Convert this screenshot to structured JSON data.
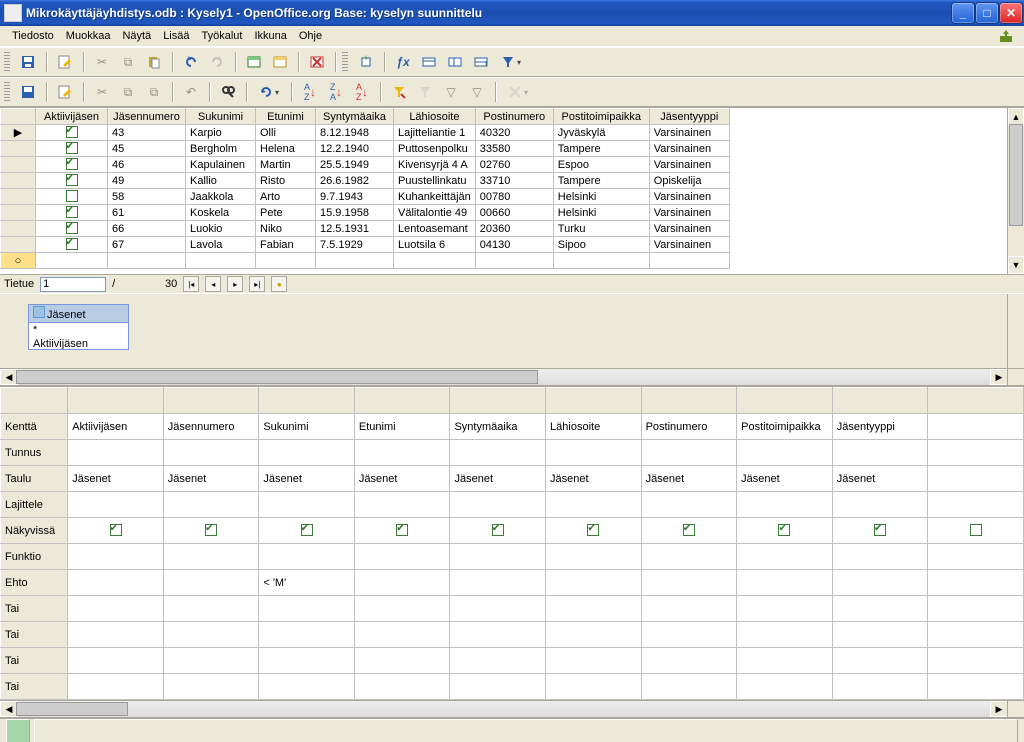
{
  "title": "Mikrokäyttäjäyhdistys.odb : Kysely1 - OpenOffice.org Base: kyselyn suunnittelu",
  "menus": [
    "Tiedosto",
    "Muokkaa",
    "Näytä",
    "Lisää",
    "Työkalut",
    "Ikkuna",
    "Ohje"
  ],
  "preview": {
    "columns": [
      "Aktiivijäsen",
      "Jäsennumero",
      "Sukunimi",
      "Etunimi",
      "Syntymäaika",
      "Lähiosoite",
      "Postinumero",
      "Postitoimipaikka",
      "Jäsentyyppi"
    ],
    "rows": [
      {
        "active": true,
        "jno": "43",
        "suk": "Karpio",
        "etu": "Olli",
        "synt": "8.12.1948",
        "lah": "Lajitteliantie 1",
        "post": "40320",
        "ptp": "Jyväskylä",
        "jt": "Varsinainen"
      },
      {
        "active": true,
        "jno": "45",
        "suk": "Bergholm",
        "etu": "Helena",
        "synt": "12.2.1940",
        "lah": "Puttosenpolku",
        "post": "33580",
        "ptp": "Tampere",
        "jt": "Varsinainen"
      },
      {
        "active": true,
        "jno": "46",
        "suk": "Kapulainen",
        "etu": "Martin",
        "synt": "25.5.1949",
        "lah": "Kivensyrjä 4 A",
        "post": "02760",
        "ptp": "Espoo",
        "jt": "Varsinainen"
      },
      {
        "active": true,
        "jno": "49",
        "suk": "Kallio",
        "etu": "Risto",
        "synt": "26.6.1982",
        "lah": "Puustellinkatu",
        "post": "33710",
        "ptp": "Tampere",
        "jt": "Opiskelija"
      },
      {
        "active": false,
        "jno": "58",
        "suk": "Jaakkola",
        "etu": "Arto",
        "synt": "9.7.1943",
        "lah": "Kuhankeittäjän",
        "post": "00780",
        "ptp": "Helsinki",
        "jt": "Varsinainen"
      },
      {
        "active": true,
        "jno": "61",
        "suk": "Koskela",
        "etu": "Pete",
        "synt": "15.9.1958",
        "lah": "Välitalontie 49",
        "post": "00660",
        "ptp": "Helsinki",
        "jt": "Varsinainen"
      },
      {
        "active": true,
        "jno": "66",
        "suk": "Luokio",
        "etu": "Niko",
        "synt": "12.5.1931",
        "lah": "Lentoasemant",
        "post": "20360",
        "ptp": "Turku",
        "jt": "Varsinainen"
      },
      {
        "active": true,
        "jno": "67",
        "suk": "Lavola",
        "etu": "Fabian",
        "synt": "7.5.1929",
        "lah": "Luotsila 6",
        "post": "04130",
        "ptp": "Sipoo",
        "jt": "Varsinainen"
      }
    ]
  },
  "recnav": {
    "label": "Tietue",
    "current": "1",
    "sep": "/",
    "total": "30"
  },
  "tablebox": {
    "title": "Jäsenet",
    "rows": [
      "*",
      "Aktiivijäsen"
    ]
  },
  "design": {
    "rowlabels": [
      "Kenttä",
      "Tunnus",
      "Taulu",
      "Lajittele",
      "Näkyvissä",
      "Funktio",
      "Ehto",
      "Tai",
      "Tai",
      "Tai",
      "Tai"
    ],
    "fields": [
      "Aktiivijäsen",
      "Jäsennumero",
      "Sukunimi",
      "Etunimi",
      "Syntymäaika",
      "Lähiosoite",
      "Postinumero",
      "Postitoimipaikka",
      "Jäsentyyppi",
      ""
    ],
    "taulu": [
      "Jäsenet",
      "Jäsenet",
      "Jäsenet",
      "Jäsenet",
      "Jäsenet",
      "Jäsenet",
      "Jäsenet",
      "Jäsenet",
      "Jäsenet",
      ""
    ],
    "visible": [
      true,
      true,
      true,
      true,
      true,
      true,
      true,
      true,
      true,
      false
    ],
    "ehto": [
      "",
      "",
      "< 'M'",
      "",
      "",
      "",
      "",
      "",
      "",
      ""
    ]
  }
}
